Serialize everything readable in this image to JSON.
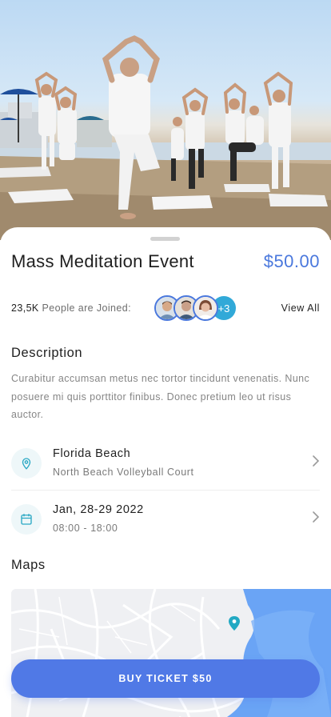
{
  "event": {
    "title": "Mass Meditation Event",
    "price": "$50.00"
  },
  "attendance": {
    "count": "23,5K",
    "label": "People are Joined:",
    "more_badge": "+3",
    "view_all": "View All"
  },
  "description": {
    "heading": "Description",
    "text": "Curabitur accumsan metus nec tortor tincidunt venenatis. Nunc posuere mi quis porttitor finibus. Donec pretium leo ut risus auctor."
  },
  "location": {
    "title": "Florida Beach",
    "subtitle": "North Beach Volleyball Court",
    "icon": "location-pin-icon"
  },
  "schedule": {
    "title": "Jan, 28-29 2022",
    "subtitle": "08:00 - 18:00",
    "icon": "calendar-icon"
  },
  "maps": {
    "heading": "Maps"
  },
  "cta": {
    "label": "BUY TICKET $50"
  },
  "colors": {
    "accent": "#4a78dd",
    "button": "#5079e6",
    "badge": "#31a9d8",
    "icon_teal": "#2aa8c4",
    "water": "#6aa4f5"
  }
}
